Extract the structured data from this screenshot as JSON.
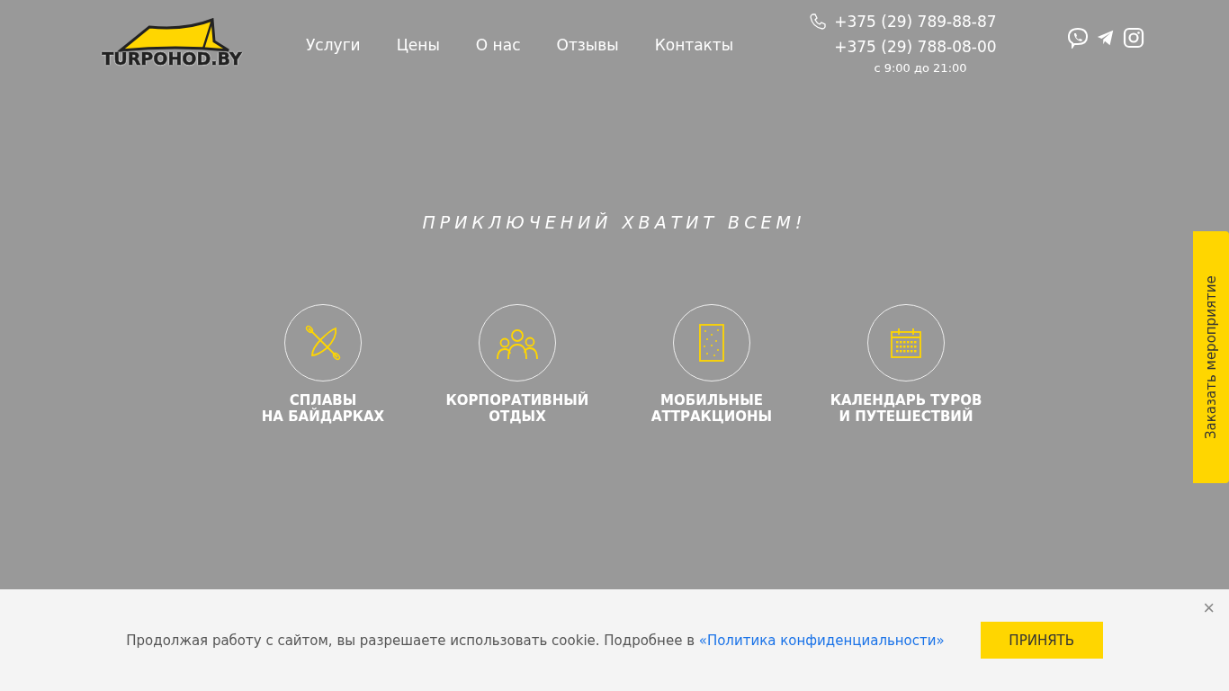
{
  "header": {
    "logo": "TURPOHOD.BY",
    "nav": [
      {
        "label": "Услуги"
      },
      {
        "label": "Цены"
      },
      {
        "label": "О нас"
      },
      {
        "label": "Отзывы"
      },
      {
        "label": "Контакты"
      }
    ],
    "phones": [
      "+375 (29) 789-88-87",
      "+375 (29) 788-08-00"
    ],
    "hours": "с 9:00 до 21:00",
    "social": [
      {
        "kind": "viber"
      },
      {
        "kind": "telegram"
      },
      {
        "kind": "instagram"
      }
    ]
  },
  "hero": {
    "tagline": "ПРИКЛЮЧЕНИЙ ХВАТИТ ВСЕМ!",
    "services": [
      {
        "kind": "kayak",
        "lines": [
          "СПЛАВЫ",
          "НА БАЙДАРКАХ"
        ]
      },
      {
        "kind": "people",
        "lines": [
          "КОРПОРАТИВНЫЙ",
          "ОТДЫХ"
        ]
      },
      {
        "kind": "board",
        "lines": [
          "МОБИЛЬНЫЕ",
          "АТТРАКЦИОНЫ"
        ]
      },
      {
        "kind": "calendar",
        "lines": [
          "КАЛЕНДАРЬ ТУРОВ",
          "И ПУТЕШЕСТВИЙ"
        ]
      }
    ]
  },
  "side_tab": "Заказать мероприятие",
  "cookie": {
    "text": "Продолжая работу с сайтом, вы разрешаете использовать cookie. Подробнее в",
    "link": "«Политика конфиденциальности»",
    "button": "ПРИНЯТЬ",
    "close": "×"
  }
}
